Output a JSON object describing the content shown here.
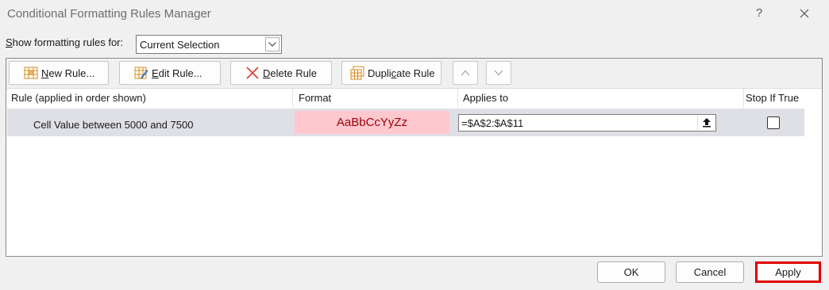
{
  "window": {
    "title": "Conditional Formatting Rules Manager",
    "help": "?"
  },
  "show_rules": {
    "label_prefix": "",
    "label_accel": "S",
    "label_rest": "how formatting rules for:",
    "selected": "Current Selection"
  },
  "toolbar": {
    "new_accel": "N",
    "new_rest": "ew Rule...",
    "edit_accel": "E",
    "edit_rest": "dit Rule...",
    "delete_accel": "D",
    "delete_rest": "elete Rule",
    "dup_prefix": "Dupli",
    "dup_accel": "c",
    "dup_rest": "ate Rule"
  },
  "table": {
    "headers": {
      "rule": "Rule (applied in order shown)",
      "format": "Format",
      "applies": "Applies to",
      "stop": "Stop If True"
    },
    "rows": [
      {
        "rule": "Cell Value between 5000 and 7500",
        "format_preview": "AaBbCcYyZz",
        "applies_to": "=$A$2:$A$11",
        "stop_if_true": false
      }
    ]
  },
  "footer": {
    "ok": "OK",
    "cancel": "Cancel",
    "apply": "Apply"
  },
  "colors": {
    "format_fill": "#ffc7ce",
    "format_text": "#9c0006",
    "highlight": "#e00000"
  },
  "icons": [
    "help-icon",
    "close-icon",
    "dropdown-arrow-icon",
    "new-rule-icon",
    "edit-rule-icon",
    "delete-rule-icon",
    "duplicate-rule-icon",
    "move-up-icon",
    "move-down-icon",
    "collapse-range-icon"
  ]
}
